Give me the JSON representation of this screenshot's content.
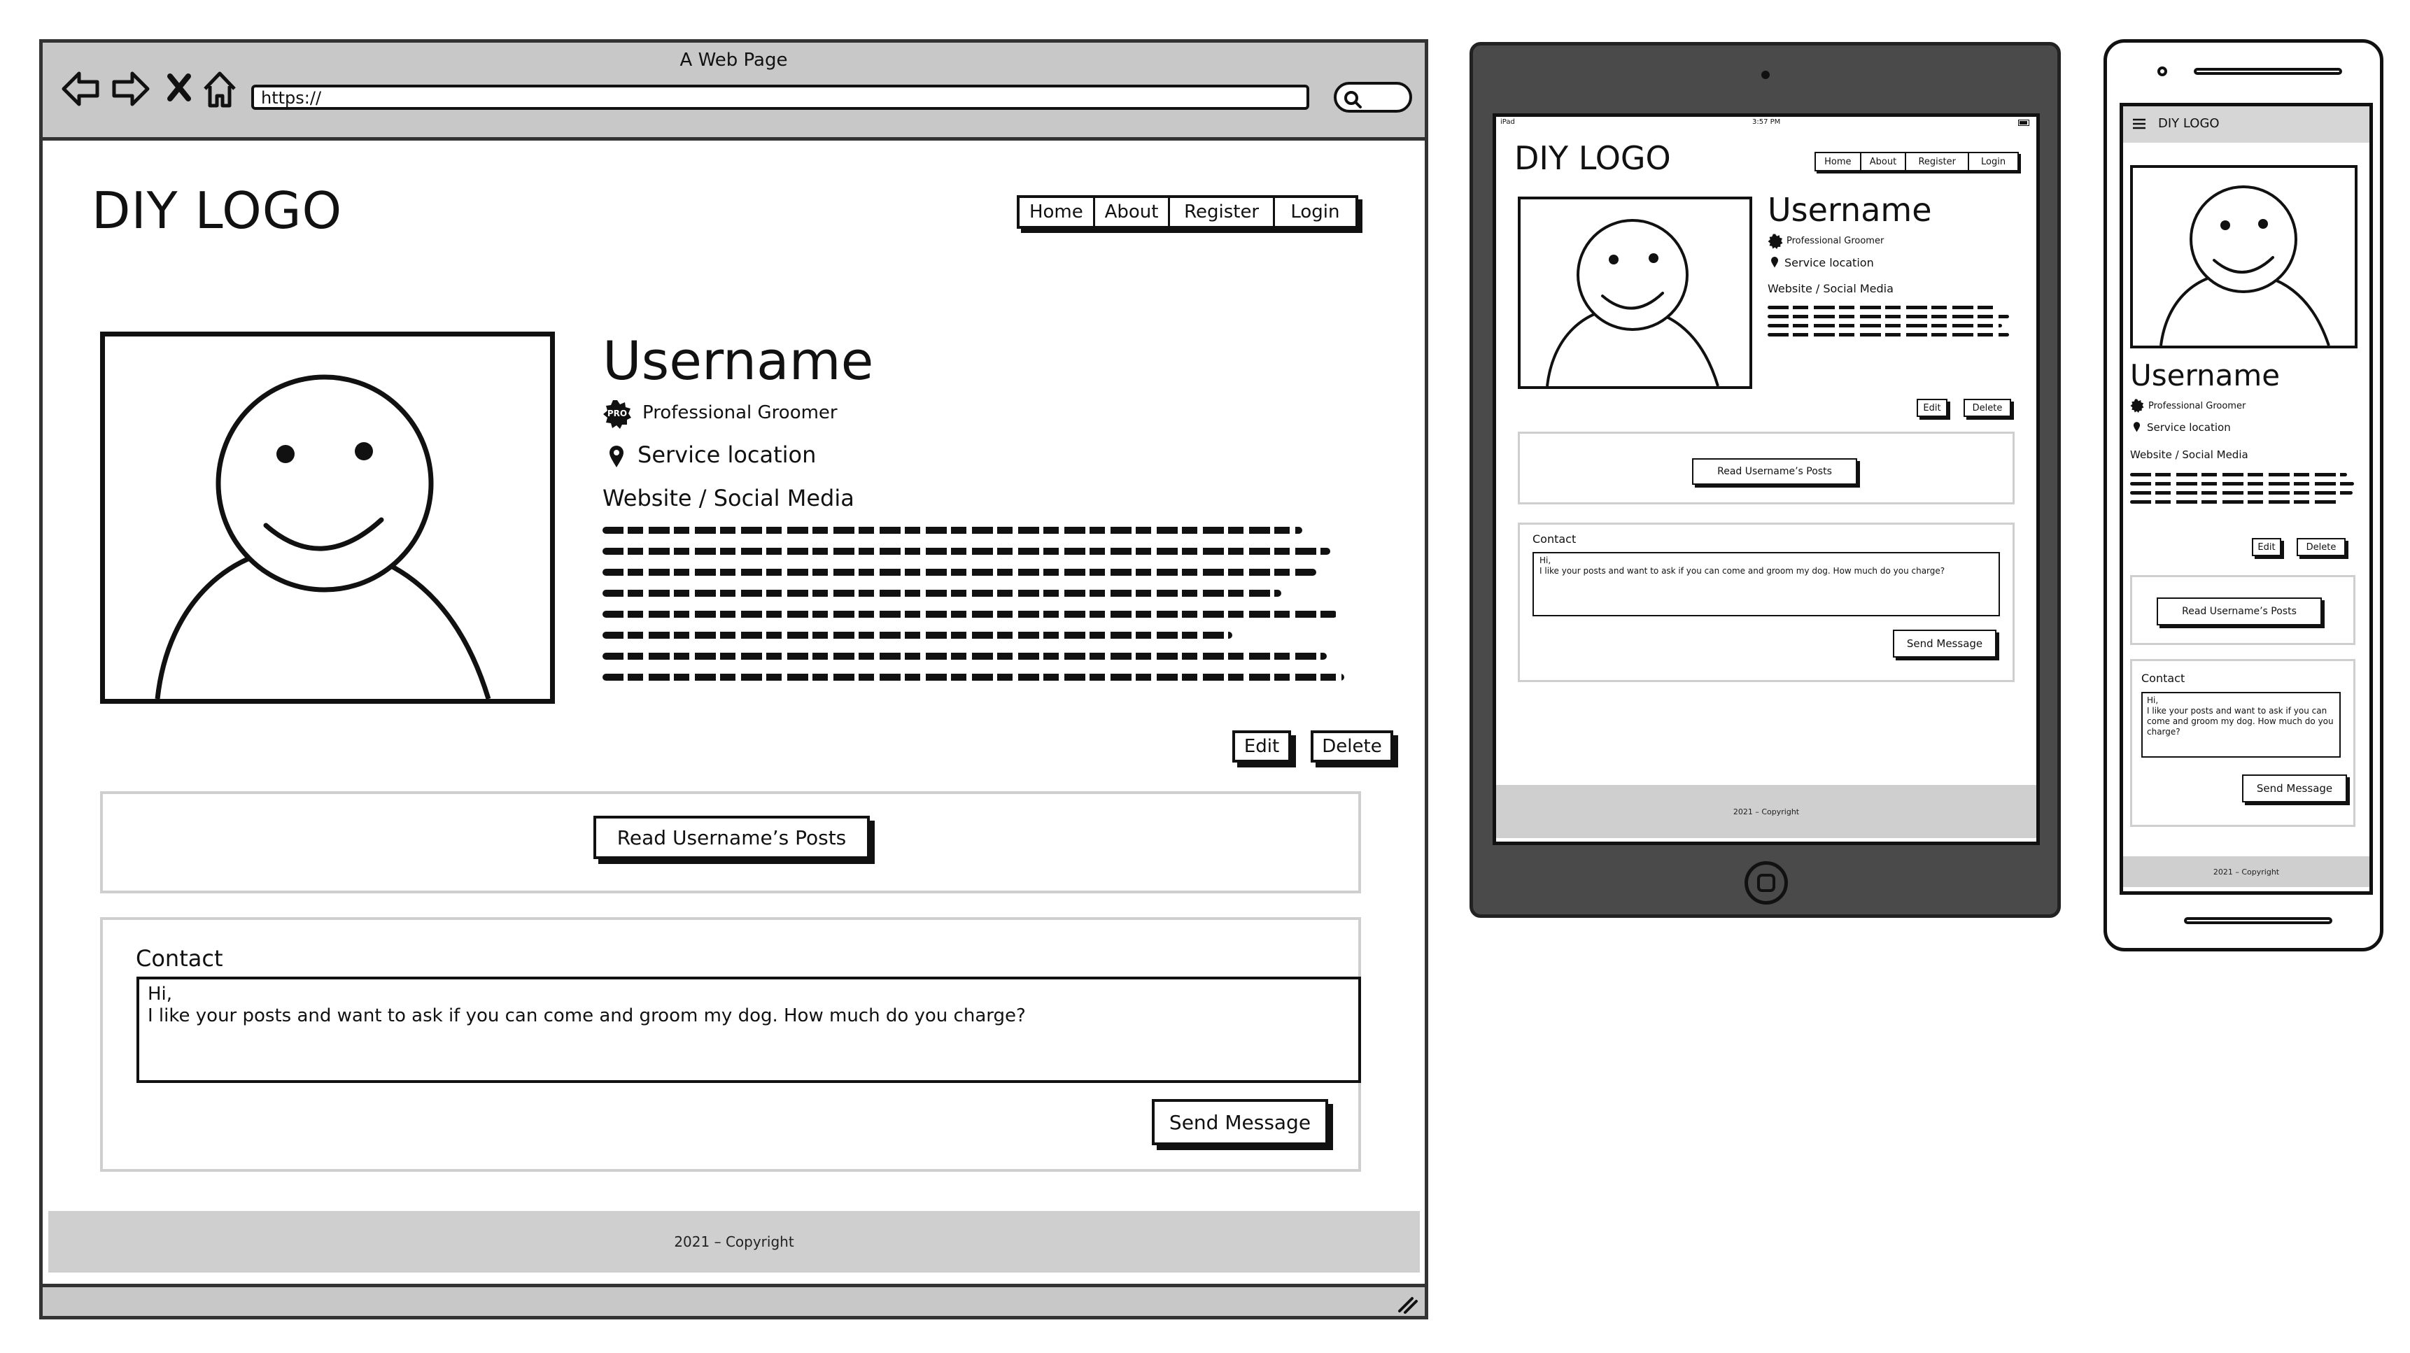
{
  "desktop": {
    "window_title": "A Web Page",
    "url": "https://",
    "logo": "DIY LOGO",
    "nav": [
      "Home",
      "About",
      "Register",
      "Login"
    ],
    "profile": {
      "username": "Username",
      "badge_icon": "pro-badge-icon",
      "badge_text": "PRO",
      "role": "Professional Groomer",
      "location": "Service location",
      "website": "Website / Social Media",
      "edit": "Edit",
      "delete": "Delete"
    },
    "read_posts": "Read Username’s Posts",
    "contact": {
      "title": "Contact",
      "message": "Hi,\nI like your posts and want to ask if you can come and groom my dog. How much do you charge?",
      "send": "Send Message"
    },
    "footer": "2021 – Copyright"
  },
  "tablet": {
    "status_left": "iPad",
    "status_time": "3:57 PM",
    "logo": "DIY LOGO",
    "nav": [
      "Home",
      "About",
      "Register",
      "Login"
    ],
    "username": "Username",
    "role": "Professional Groomer",
    "location": "Service location",
    "website": "Website / Social Media",
    "edit": "Edit",
    "delete": "Delete",
    "read_posts": "Read Username’s Posts",
    "contact_title": "Contact",
    "message": "Hi,\nI like your posts and want to ask if you can come and groom my dog. How much do you charge?",
    "send": "Send Message",
    "footer": "2021 – Copyright"
  },
  "phone": {
    "menu_icon": "hamburger-menu-icon",
    "logo": "DIY LOGO",
    "username": "Username",
    "role": "Professional Groomer",
    "location": "Service location",
    "website": "Website / Social Media",
    "edit": "Edit",
    "delete": "Delete",
    "read_posts": "Read Username’s Posts",
    "contact_title": "Contact",
    "message": "Hi,\nI like your posts and want to ask if you can come and groom my dog. How much do you charge?",
    "send": "Send Message",
    "footer": "2021 – Copyright"
  },
  "colors": {
    "chrome": "#c8c8c8",
    "footer": "#cfcfcf",
    "tablet_body": "#4a4a4a",
    "ink": "#111111"
  }
}
